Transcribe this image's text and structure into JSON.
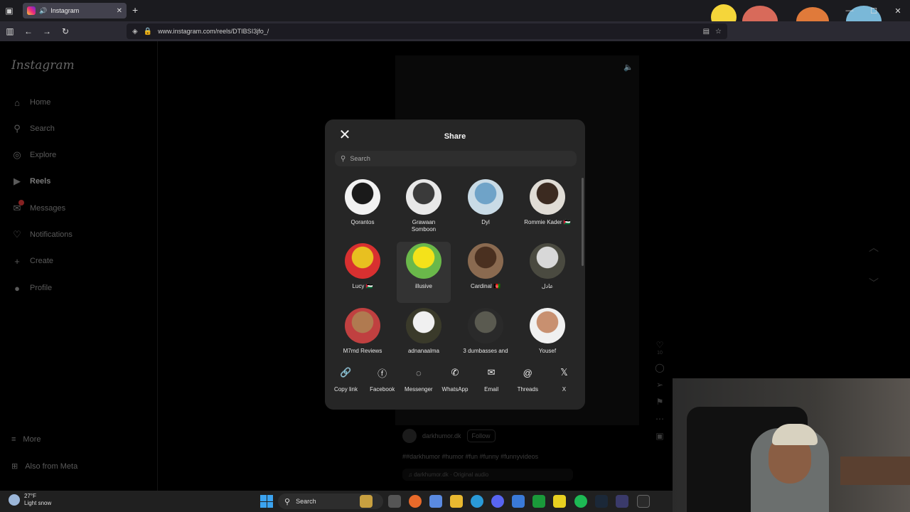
{
  "browser": {
    "tab_title": "Instagram",
    "new_tab": "+",
    "url": "www.instagram.com/reels/DTIBSI3jfo_/"
  },
  "sidebar": {
    "logo": "Instagram",
    "items": [
      {
        "label": "Home",
        "icon": "home-icon",
        "glyph": "⌂"
      },
      {
        "label": "Search",
        "icon": "search-icon",
        "glyph": "⚲"
      },
      {
        "label": "Explore",
        "icon": "compass-icon",
        "glyph": "◎"
      },
      {
        "label": "Reels",
        "icon": "reels-icon",
        "glyph": "▶"
      },
      {
        "label": "Messages",
        "icon": "messenger-icon",
        "glyph": "✉"
      },
      {
        "label": "Notifications",
        "icon": "heart-icon",
        "glyph": "♡"
      },
      {
        "label": "Create",
        "icon": "plus-icon",
        "glyph": "+"
      },
      {
        "label": "Profile",
        "icon": "avatar-icon",
        "glyph": "●"
      }
    ],
    "more": "More",
    "also_from_meta": "Also from Meta"
  },
  "reel": {
    "username": "darkhumor.dk",
    "follow": "Follow",
    "caption": "##darkhumor #humor #fun #funny #funnyvideos",
    "audio": "darkhumor.dk · Original audio",
    "like_count": "10"
  },
  "share_modal": {
    "title": "Share",
    "search_placeholder": "Search",
    "contacts": [
      {
        "name": "Qorantos",
        "color": "#1a1a1a",
        "bg": "#f2f2f2"
      },
      {
        "name": "Grawaan\nSomboon",
        "color": "#3a3a3a",
        "bg": "#e8e8e8"
      },
      {
        "name": "Dyl",
        "color": "#6fa3c8",
        "bg": "#c9dbe6"
      },
      {
        "name": "Rommie Kader 🇵🇸",
        "color": "#3b2a20",
        "bg": "#e0dcd5"
      },
      {
        "name": "Lucy 🇵🇸",
        "color": "#e8c020",
        "bg": "#d83030"
      },
      {
        "name": "illusive",
        "color": "#f4e21a",
        "bg": "#6ab84a"
      },
      {
        "name": "Cardinal 🇦🇫",
        "color": "#4a3020",
        "bg": "#8a6a50"
      },
      {
        "name": "عادل",
        "color": "#d8d8d8",
        "bg": "#4a4a40"
      },
      {
        "name": "M7md Reviews",
        "color": "#b07a50",
        "bg": "#c04040"
      },
      {
        "name": "adnanaalma",
        "color": "#f0f0f0",
        "bg": "#3a3a2a"
      },
      {
        "name": "3 dumbasses and",
        "color": "#5a5a50",
        "bg": "#2a2a2a"
      },
      {
        "name": "Yousef",
        "color": "#c89070",
        "bg": "#f0f0f0"
      }
    ],
    "apps": [
      {
        "label": "Copy link",
        "icon": "link-icon",
        "glyph": "🔗"
      },
      {
        "label": "Facebook",
        "icon": "facebook-icon",
        "glyph": "ⓕ"
      },
      {
        "label": "Messenger",
        "icon": "messenger-icon",
        "glyph": "◌"
      },
      {
        "label": "WhatsApp",
        "icon": "whatsapp-icon",
        "glyph": "✆"
      },
      {
        "label": "Email",
        "icon": "email-icon",
        "glyph": "✉"
      },
      {
        "label": "Threads",
        "icon": "threads-icon",
        "glyph": "@"
      },
      {
        "label": "X",
        "icon": "x-icon",
        "glyph": "𝕏"
      }
    ]
  },
  "taskbar": {
    "temperature": "27°F",
    "weather": "Light snow",
    "search_label": "Search"
  }
}
